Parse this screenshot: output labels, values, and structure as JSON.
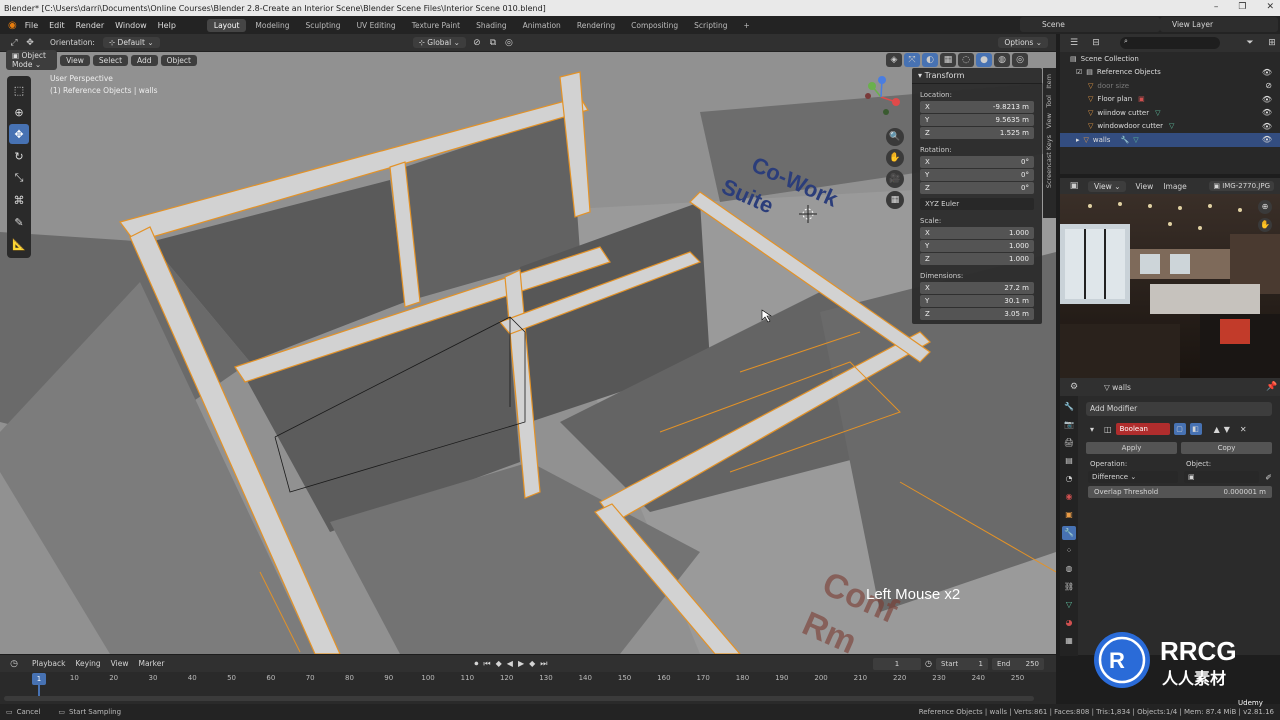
{
  "window": {
    "title": "Blender* [C:\\Users\\darri\\Documents\\Online Courses\\Blender 2.8-Create an Interior Scene\\Blender Scene Files\\Interior Scene 010.blend]",
    "controls": [
      "–",
      "❐",
      "✕"
    ]
  },
  "topbar": {
    "menus": [
      "File",
      "Edit",
      "Render",
      "Window",
      "Help"
    ],
    "workspaces": [
      "Layout",
      "Modeling",
      "Sculpting",
      "UV Editing",
      "Texture Paint",
      "Shading",
      "Animation",
      "Rendering",
      "Compositing",
      "Scripting"
    ],
    "active_workspace": "Layout",
    "add_tab": "+",
    "scene": "Scene",
    "view_layer": "View Layer"
  },
  "viewport_header": {
    "orientation_label": "Orientation:",
    "orientation_value": "Default",
    "transform_orientation": "Global",
    "options": "Options",
    "mode": "Object Mode",
    "menus": [
      "View",
      "Select",
      "Add",
      "Object"
    ]
  },
  "viewport": {
    "perspective": "User Perspective",
    "active_object": "(1) Reference Objects | walls",
    "floor_text_1": "Co-Work",
    "floor_text_2": "Suite",
    "floor_text_3": "Conf",
    "floor_text_4": "Rm",
    "keypress": "Left Mouse x2"
  },
  "npanel": {
    "header": "Transform",
    "location_label": "Location:",
    "location": [
      {
        "axis": "X",
        "value": "-9.8213 m"
      },
      {
        "axis": "Y",
        "value": "9.5635 m"
      },
      {
        "axis": "Z",
        "value": "1.525 m"
      }
    ],
    "rotation_label": "Rotation:",
    "rotation": [
      {
        "axis": "X",
        "value": "0°"
      },
      {
        "axis": "Y",
        "value": "0°"
      },
      {
        "axis": "Z",
        "value": "0°"
      }
    ],
    "rotation_mode": "XYZ Euler",
    "scale_label": "Scale:",
    "scale": [
      {
        "axis": "X",
        "value": "1.000"
      },
      {
        "axis": "Y",
        "value": "1.000"
      },
      {
        "axis": "Z",
        "value": "1.000"
      }
    ],
    "dimensions_label": "Dimensions:",
    "dimensions": [
      {
        "axis": "X",
        "value": "27.2 m"
      },
      {
        "axis": "Y",
        "value": "30.1 m"
      },
      {
        "axis": "Z",
        "value": "3.05 m"
      }
    ],
    "side_tabs": [
      "Item",
      "Tool",
      "View",
      "Screencast Keys"
    ]
  },
  "outliner": {
    "root": "Scene Collection",
    "items": [
      {
        "label": "Reference Objects",
        "dim": false,
        "selected": false
      },
      {
        "label": "door size",
        "dim": true,
        "selected": false
      },
      {
        "label": "Floor plan",
        "dim": false,
        "selected": false
      },
      {
        "label": "wiindow cutter",
        "dim": false,
        "selected": false
      },
      {
        "label": "windowdoor cutter",
        "dim": false,
        "selected": false
      },
      {
        "label": "walls",
        "dim": false,
        "selected": true
      }
    ]
  },
  "image_editor": {
    "menus": [
      "View",
      "View",
      "Image"
    ],
    "image_name": "IMG-2770.JPG"
  },
  "properties": {
    "object": "walls",
    "add_modifier": "Add Modifier",
    "modifier_name": "Boolean",
    "apply": "Apply",
    "copy": "Copy",
    "operation_label": "Operation:",
    "operation_value": "Difference",
    "object_label": "Object:",
    "overlap_label": "Overlap Threshold",
    "overlap_value": "0.000001 m"
  },
  "timeline": {
    "menus": [
      "Playback",
      "Keying",
      "View",
      "Marker"
    ],
    "current_frame": "1",
    "start_label": "Start",
    "start": "1",
    "end_label": "End",
    "end": "250",
    "ticks": [
      "1",
      "10",
      "20",
      "30",
      "40",
      "50",
      "60",
      "70",
      "80",
      "90",
      "100",
      "110",
      "120",
      "130",
      "140",
      "150",
      "160",
      "170",
      "180",
      "190",
      "200",
      "210",
      "220",
      "230",
      "240",
      "250"
    ]
  },
  "statusbar": {
    "left1": "Cancel",
    "left2": "Start Sampling",
    "stats": "Reference Objects | walls | Verts:861 | Faces:808 | Tris:1,834 | Objects:1/4 | Mem: 87.4 MiB | v2.81.16"
  },
  "branding": {
    "watermark": "RRCG",
    "watermark_cn": "人人素材",
    "udemy": "Udemy"
  },
  "colors": {
    "accent": "#4772b3",
    "selection_outline": "#f0a030",
    "modifier_red": "#b02d2d"
  }
}
